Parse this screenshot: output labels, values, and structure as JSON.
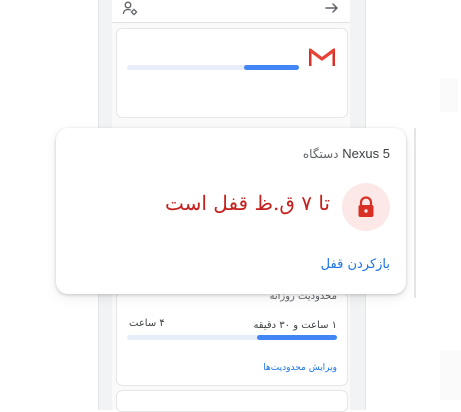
{
  "device": {
    "prefix": "دستگاه",
    "name": "Nexus 5"
  },
  "lock": {
    "title": "تا ۷ ق.ظ قفل است",
    "unlock_label": "بازکردن قفل"
  },
  "usage": {
    "section_label": "محدودیت روزانه",
    "used": "۱ ساعت و ۳۰ دقیقه",
    "limit": "۴ ساعت",
    "progress_fraction": 0.38,
    "edit_label": "ویرایش محدودیت‌ها"
  },
  "app_usage": {
    "progress_fraction": 0.32
  },
  "icons": {
    "top_left": "user-settings-icon",
    "top_right": "arrow-forward-icon",
    "app": "gmail-icon",
    "lock": "lock-icon"
  },
  "colors": {
    "accent_blue": "#4285f4",
    "link_blue": "#1a73e8",
    "lock_red": "#c5221f",
    "lock_bg": "#fce8e6"
  }
}
